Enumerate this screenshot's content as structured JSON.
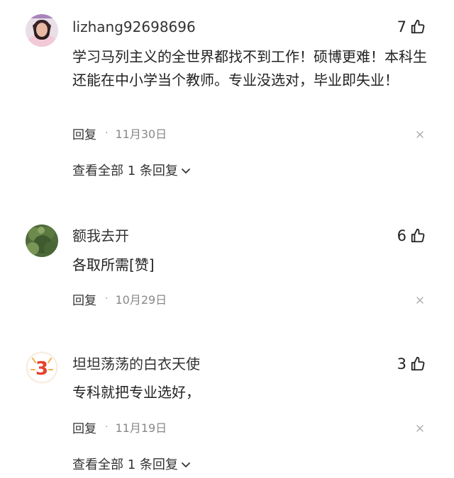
{
  "comments": [
    {
      "username": "lizhang92698696",
      "likes": "7",
      "text": "学习马列主义的全世界都找不到工作！硕博更难！本科生还能在中小学当个教师。专业没选对，毕业即失业！",
      "reply_label": "回复",
      "separator": "·",
      "date": "11月30日",
      "view_replies": "查看全部 1 条回复"
    },
    {
      "username": "额我去开",
      "likes": "6",
      "text": "各取所需[赞]",
      "reply_label": "回复",
      "separator": "·",
      "date": "10月29日"
    },
    {
      "username": "坦坦荡荡的白衣天使",
      "likes": "3",
      "text": "专科就把专业选好，",
      "reply_label": "回复",
      "separator": "·",
      "date": "11月19日",
      "view_replies": "查看全部 1 条回复"
    }
  ],
  "avatar3_glyph": "3",
  "icons": [
    "thumbs-up-icon",
    "close-icon",
    "chevron-down-icon"
  ]
}
